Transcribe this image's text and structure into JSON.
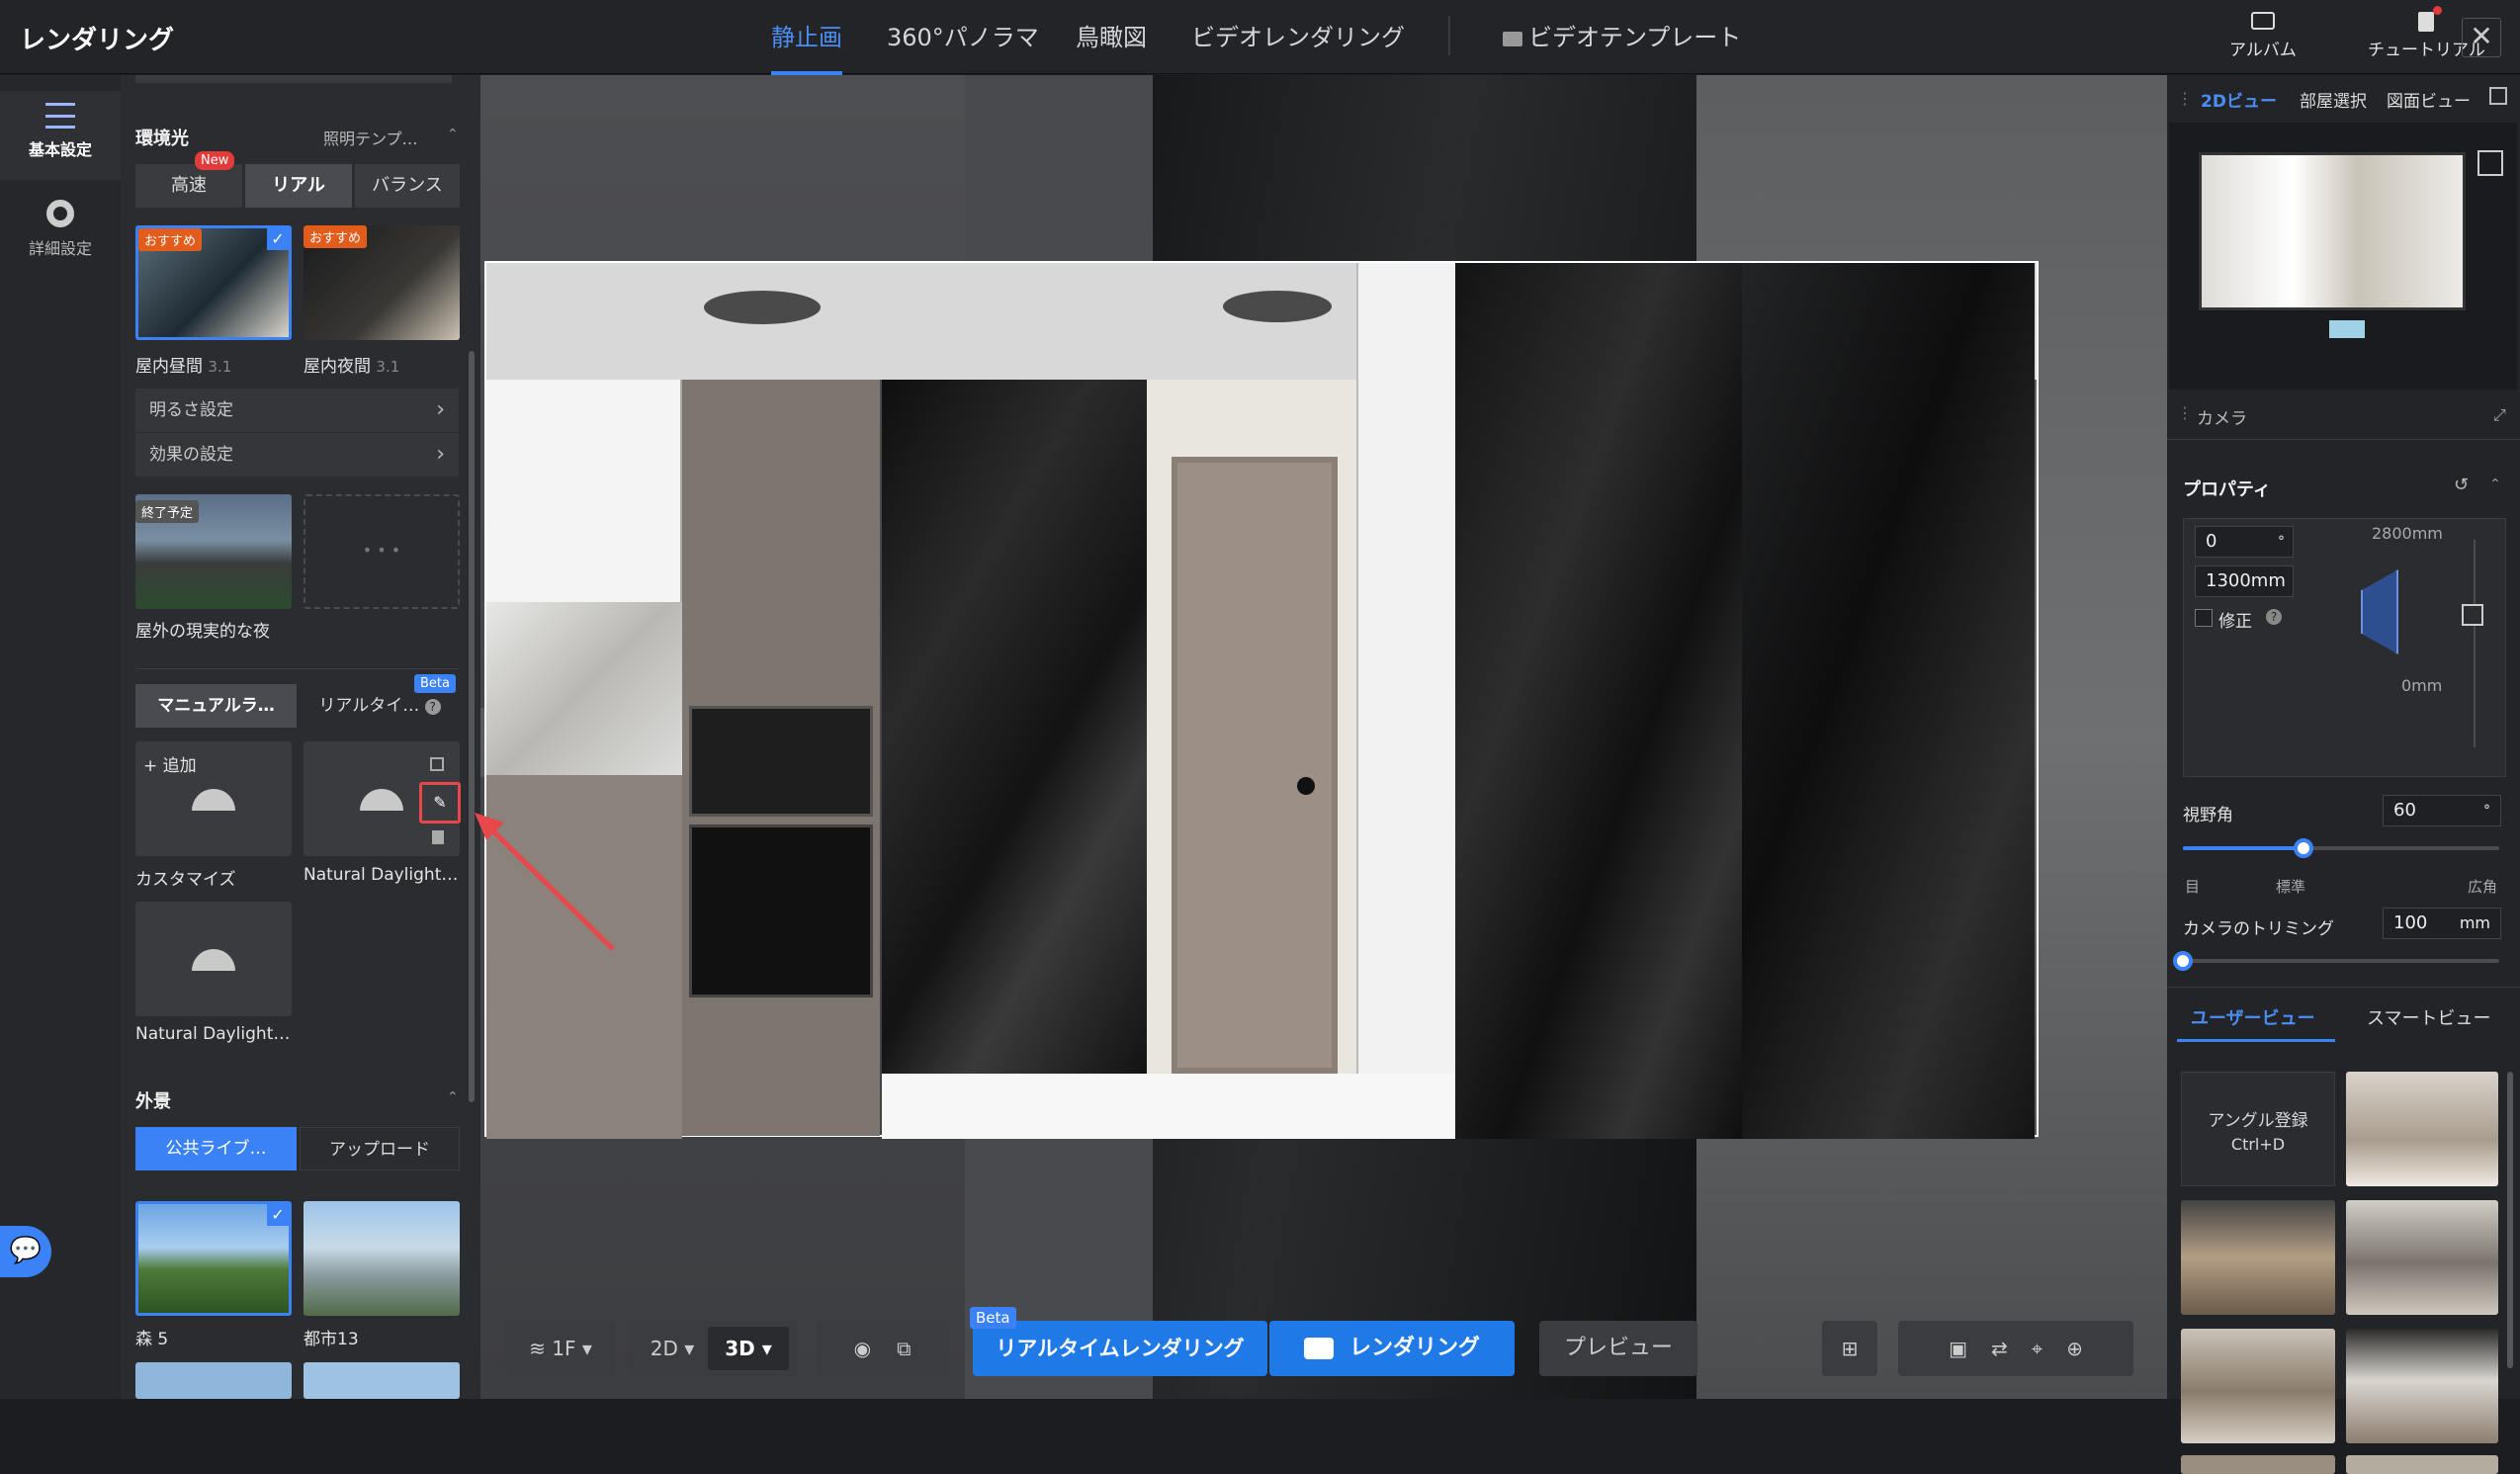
{
  "app": {
    "title": "レンダリング"
  },
  "topnav": {
    "tabs": [
      "静止画",
      "360°パノラマ",
      "鳥瞰図",
      "ビデオレンダリング"
    ],
    "video_template": "ビデオテンプレート",
    "album": "アルバム",
    "tutorial": "チュートリアル",
    "close": "✕"
  },
  "leftrail": {
    "basic": "基本設定",
    "advanced": "詳細設定"
  },
  "lighting": {
    "section": "環境光",
    "template_link": "照明テンプ…",
    "modes": [
      "高速",
      "リアル",
      "バランス"
    ],
    "new_badge": "New",
    "presets": [
      {
        "badge": "おすすめ",
        "name": "屋内昼間",
        "version": "3.1"
      },
      {
        "badge": "おすすめ",
        "name": "屋内夜間",
        "version": "3.1"
      }
    ],
    "brightness": "明るさ設定",
    "effect": "効果の設定",
    "outdoor": {
      "badge": "終了予定",
      "name": "屋外の現実的な夜"
    },
    "more": "• • •"
  },
  "manual_light": {
    "tab_manual": "マニュアルラ…",
    "tab_realtime": "リアルタイ…",
    "beta": "Beta",
    "add": "+ 追加",
    "items": [
      "カスタマイズ",
      "Natural Daylight…",
      "Natural Daylight…"
    ]
  },
  "exterior": {
    "section": "外景",
    "tab_public": "公共ライブ…",
    "tab_upload": "アップロード",
    "items": [
      "森 5",
      "都市13"
    ]
  },
  "bottom_toolbar": {
    "floor": "1F",
    "view2d": "2D",
    "view3d": "3D",
    "beta": "Beta",
    "realtime": "リアルタイムレンダリング",
    "render": "レンダリング",
    "preview": "プレビュー"
  },
  "right": {
    "tabs": [
      "2Dビュー",
      "部屋選択",
      "図面ビュー"
    ],
    "camera": "カメラ",
    "properties": "プロパティ",
    "angle": "0",
    "angle_unit": "°",
    "height": "1300mm",
    "correction": "修正",
    "max_height": "2800mm",
    "min_height": "0mm",
    "fov_label": "視野角",
    "fov_value": "60",
    "fov_unit": "°",
    "fov_ticks": [
      "目",
      "標準",
      "広角"
    ],
    "fov_level": 0.38,
    "trim_label": "カメラのトリミング",
    "trim_value": "100",
    "trim_unit": "mm",
    "trim_level": 0.0,
    "view_tabs": [
      "ユーザービュー",
      "スマートビュー"
    ],
    "angle_register": "アングル登録",
    "shortcut": "Ctrl+D"
  },
  "colors": {
    "accent": "#3b82f6",
    "badge_orange": "#e25c1c",
    "badge_red": "#e23b3b",
    "annotation": "#e8474b"
  }
}
